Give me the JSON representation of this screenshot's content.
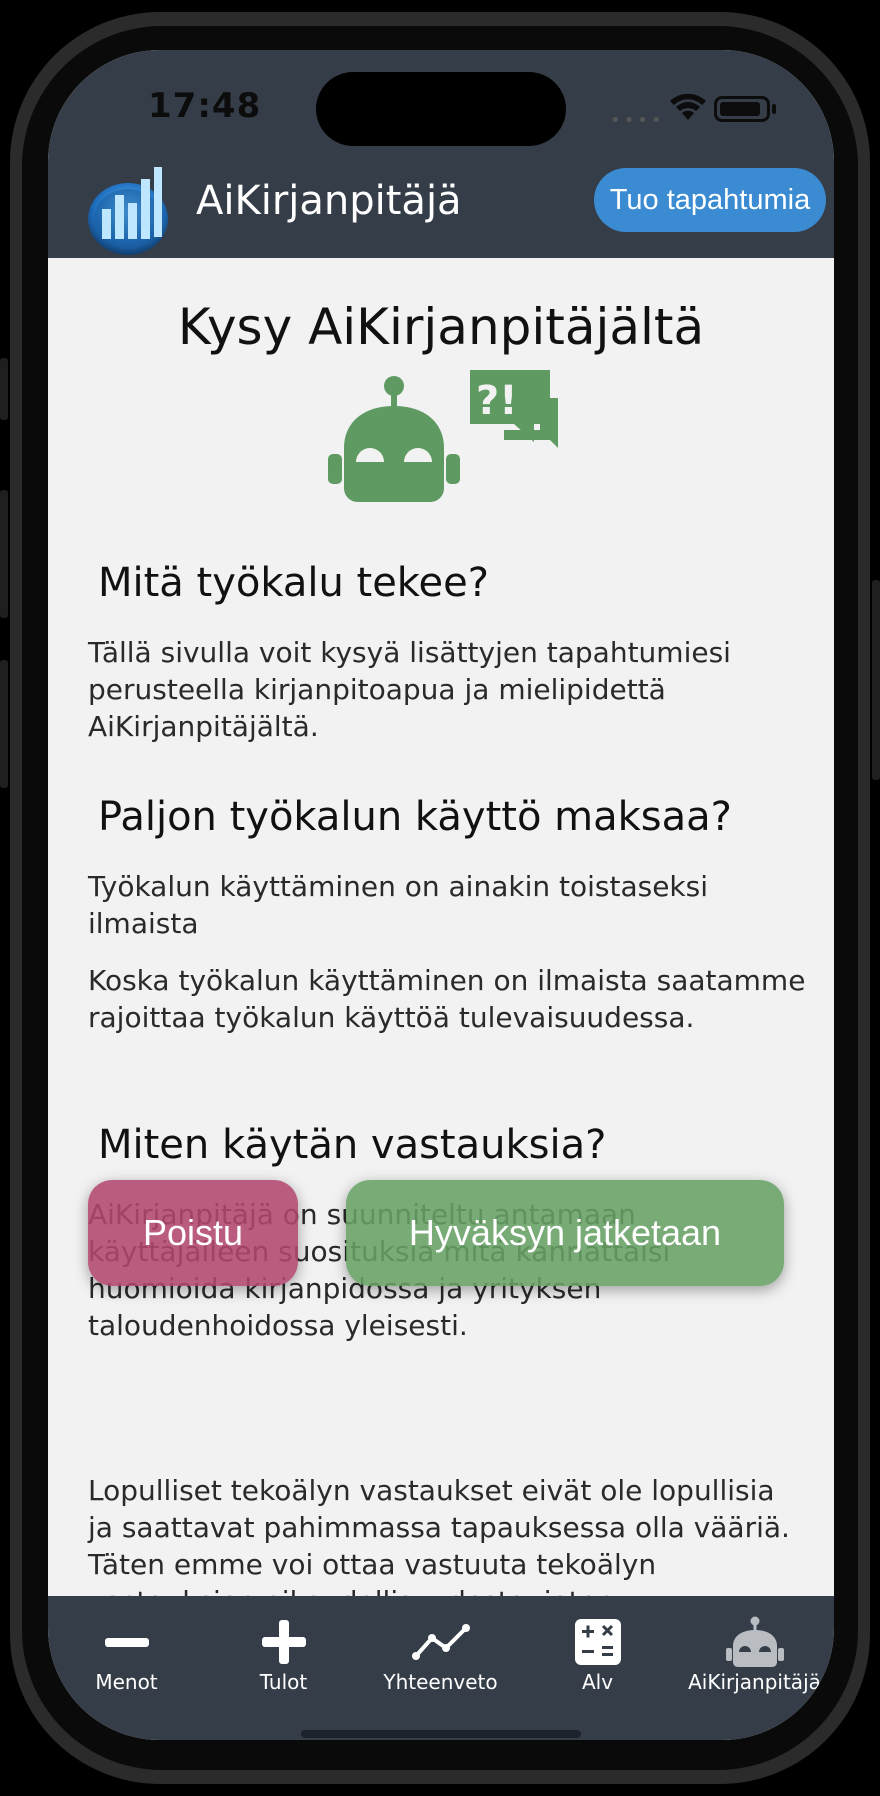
{
  "status": {
    "time": "17:48"
  },
  "header": {
    "app_title": "AiKirjanpitäjä",
    "import_button": "Tuo tapahtumia"
  },
  "main": {
    "title": "Kysy AiKirjanpitäjältä",
    "sections": [
      {
        "heading": "Mitä työkalu tekee?",
        "paragraphs": [
          "Tällä sivulla voit kysyä lisättyjen tapahtumiesi perusteella kirjanpitoapua ja mielipidettä AiKirjanpitäjältä."
        ]
      },
      {
        "heading": "Paljon työkalun käyttö maksaa?",
        "paragraphs": [
          "Työkalun käyttäminen on ainakin toistaseksi ilmaista",
          "Koska työkalun käyttäminen on ilmaista saatamme rajoittaa työkalun käyttöä tulevaisuudessa."
        ]
      },
      {
        "heading": "Miten käytän vastauksia?",
        "paragraphs": [
          "AiKirjanpitäjä on suunniteltu antamaan käyttäjälleen suosituksia mitä kannattaisi huomioida kirjanpidossa ja yrityksen taloudenhoidossa yleisesti.",
          "Lopulliset tekoälyn vastaukset eivät ole lopullisia ja saattavat pahimmassa tapauksessa olla vääriä. Täten emme voi ottaa vastuuta tekoälyn vastauksien oikeudellisuudesta, joten"
        ]
      }
    ]
  },
  "actions": {
    "exit": "Poistu",
    "accept": "Hyväksyn jatketaan"
  },
  "nav": {
    "items": [
      {
        "label": "Menot",
        "icon": "minus-icon"
      },
      {
        "label": "Tulot",
        "icon": "plus-icon"
      },
      {
        "label": "Yhteenveto",
        "icon": "chart-line-icon"
      },
      {
        "label": "Alv",
        "icon": "calculator-icon"
      },
      {
        "label": "AiKirjanpitäjä",
        "icon": "robot-icon"
      }
    ]
  },
  "colors": {
    "header_bg": "#353e48",
    "accent_blue": "#3b8bd2",
    "exit_pink": "#b24770",
    "accept_green": "#66a064",
    "robot_green": "#5e9a62"
  }
}
